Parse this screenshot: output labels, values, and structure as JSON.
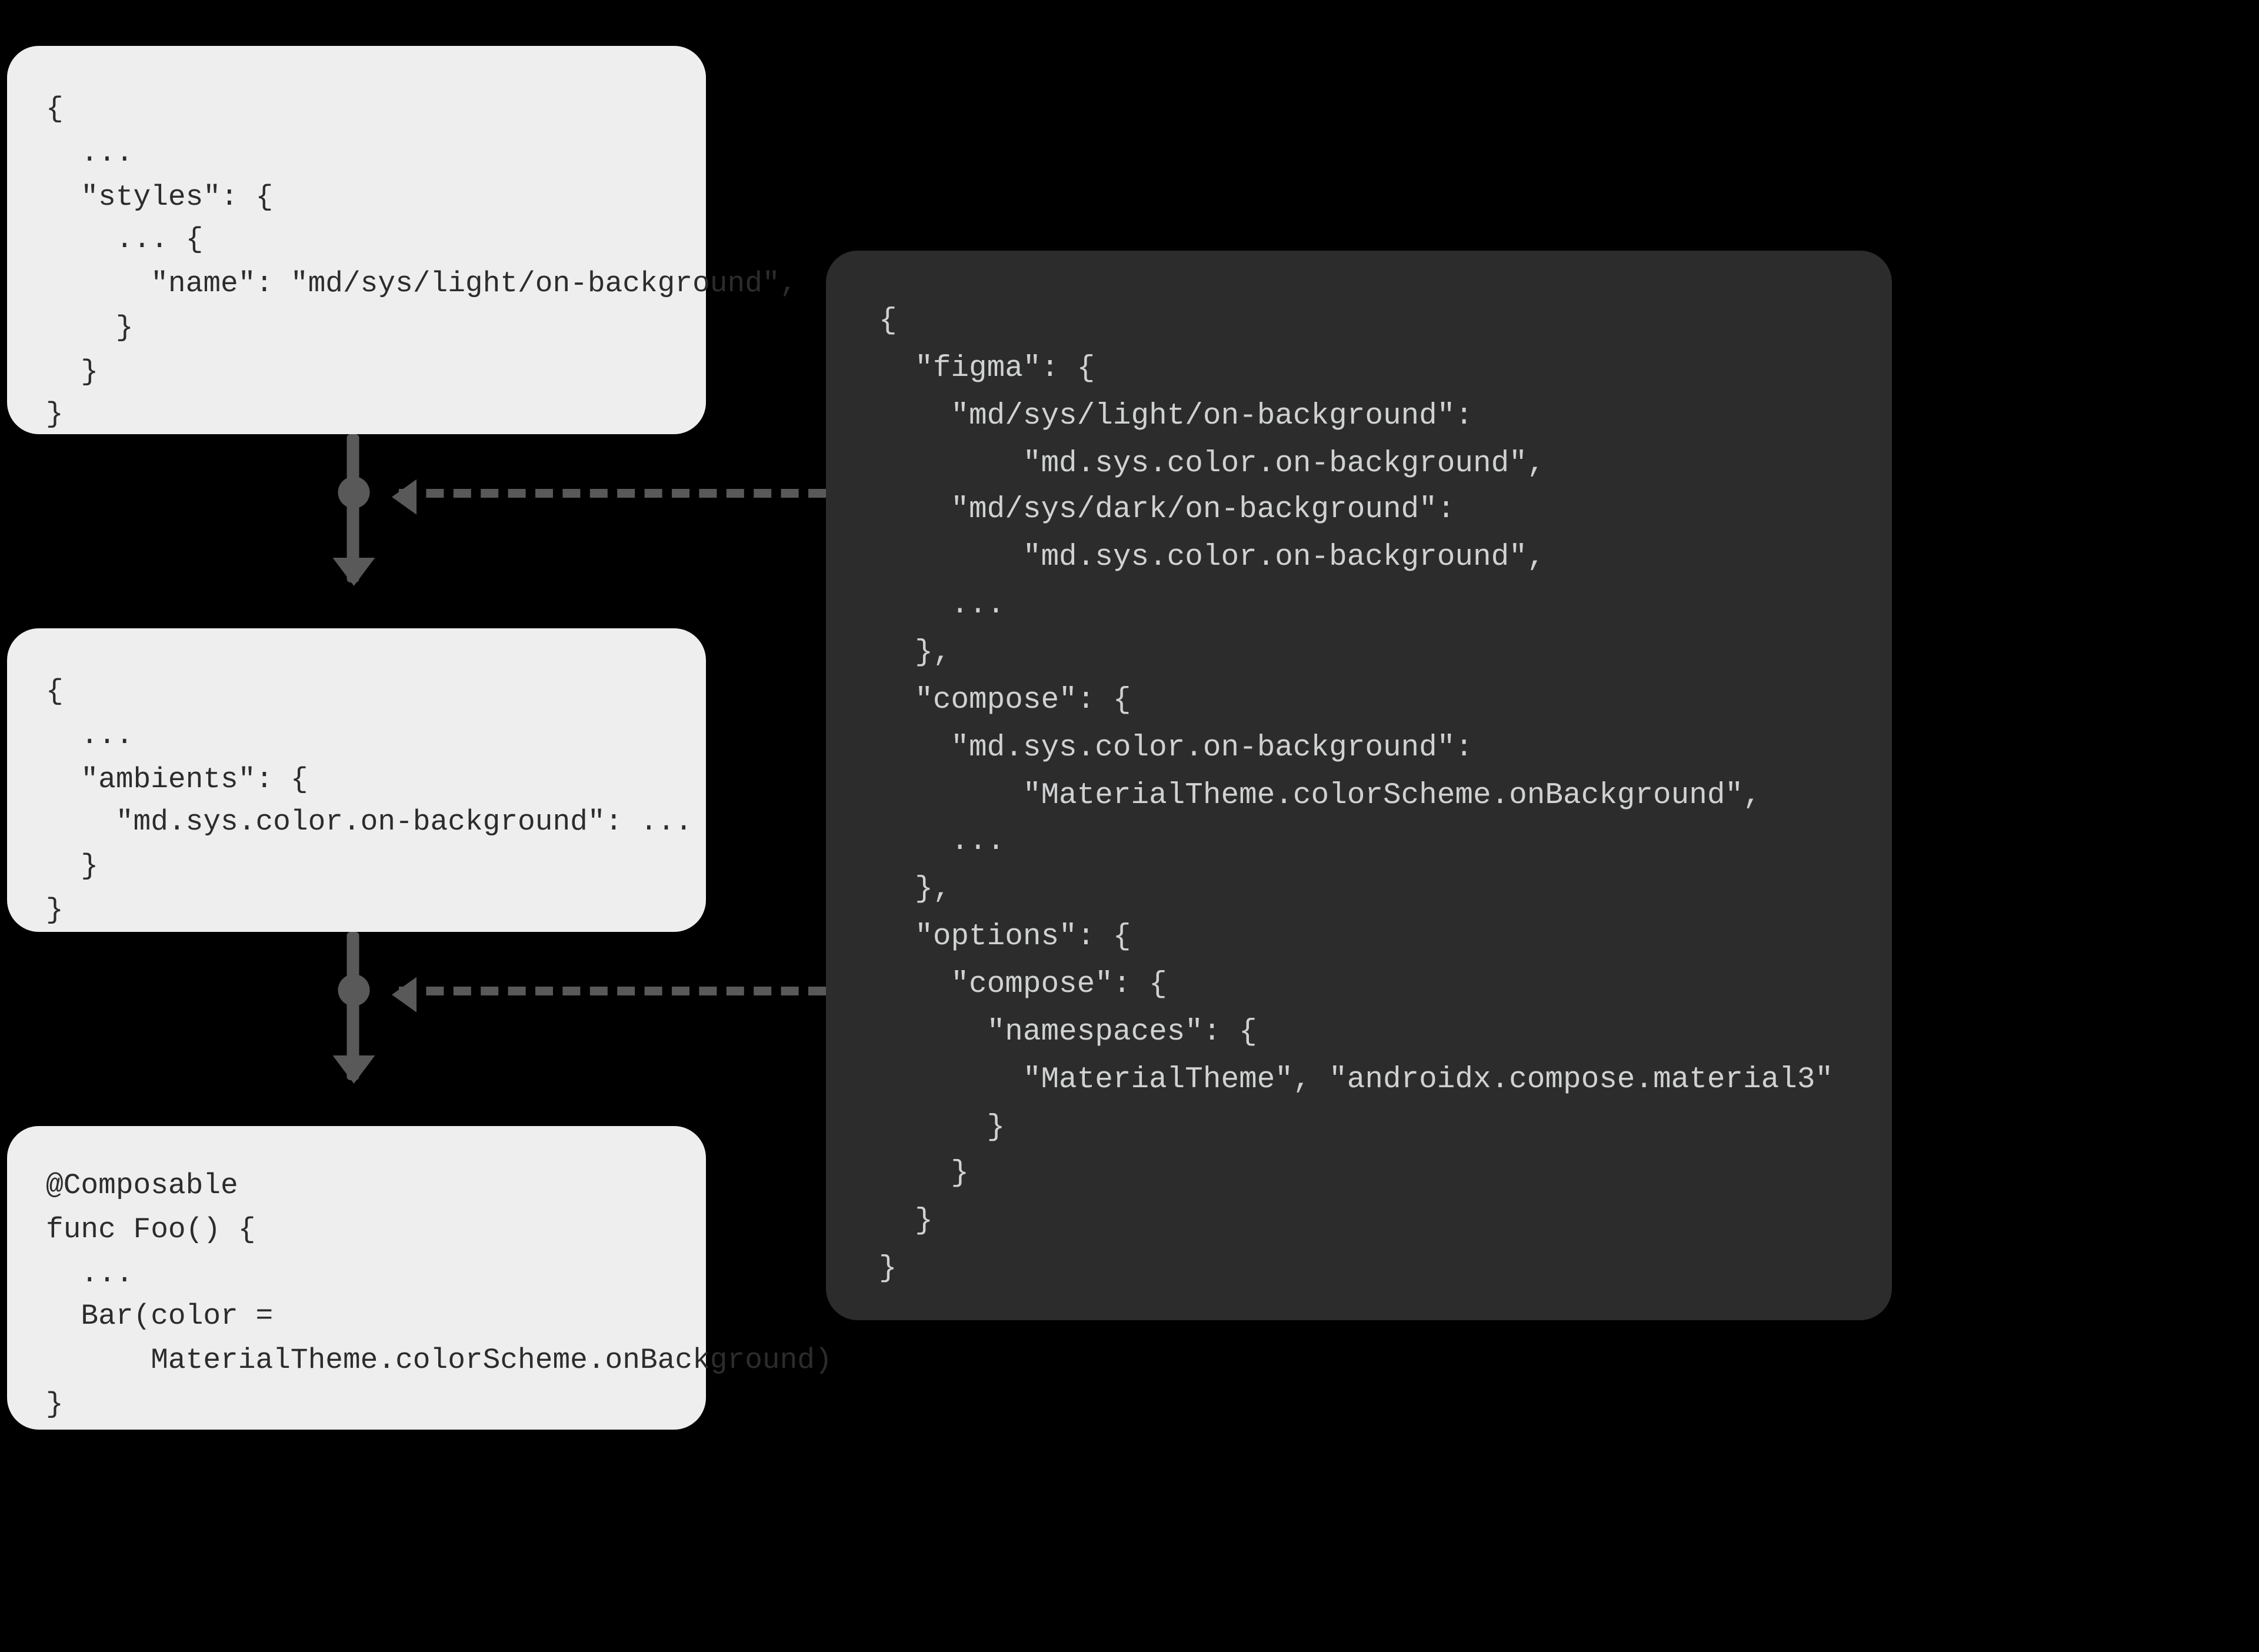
{
  "left_cards": {
    "styles": {
      "lines": [
        "{",
        "  ...",
        "  \"styles\": {",
        "    ... {",
        "      \"name\": \"md/sys/light/on-background\",",
        "    }",
        "  }",
        "}"
      ]
    },
    "ambients": {
      "lines": [
        "{",
        "  ...",
        "  \"ambients\": {",
        "    \"md.sys.color.on-background\": ...",
        "  }",
        "}"
      ]
    },
    "compose_code": {
      "lines": [
        "@Composable",
        "func Foo() {",
        "  ...",
        "  Bar(color =",
        "      MaterialTheme.colorScheme.onBackground)",
        "}"
      ]
    }
  },
  "right_card": {
    "lines": [
      "{",
      "  \"figma\": {",
      "    \"md/sys/light/on-background\":",
      "        \"md.sys.color.on-background\",",
      "    \"md/sys/dark/on-background\":",
      "        \"md.sys.color.on-background\",",
      "    ...",
      "  },",
      "  \"compose\": {",
      "    \"md.sys.color.on-background\":",
      "        \"MaterialTheme.colorScheme.onBackground\",",
      "    ...",
      "  },",
      "  \"options\": {",
      "    \"compose\": {",
      "      \"namespaces\": {",
      "        \"MaterialTheme\", \"androidx.compose.material3\"",
      "      }",
      "    }",
      "  }",
      "}"
    ]
  }
}
